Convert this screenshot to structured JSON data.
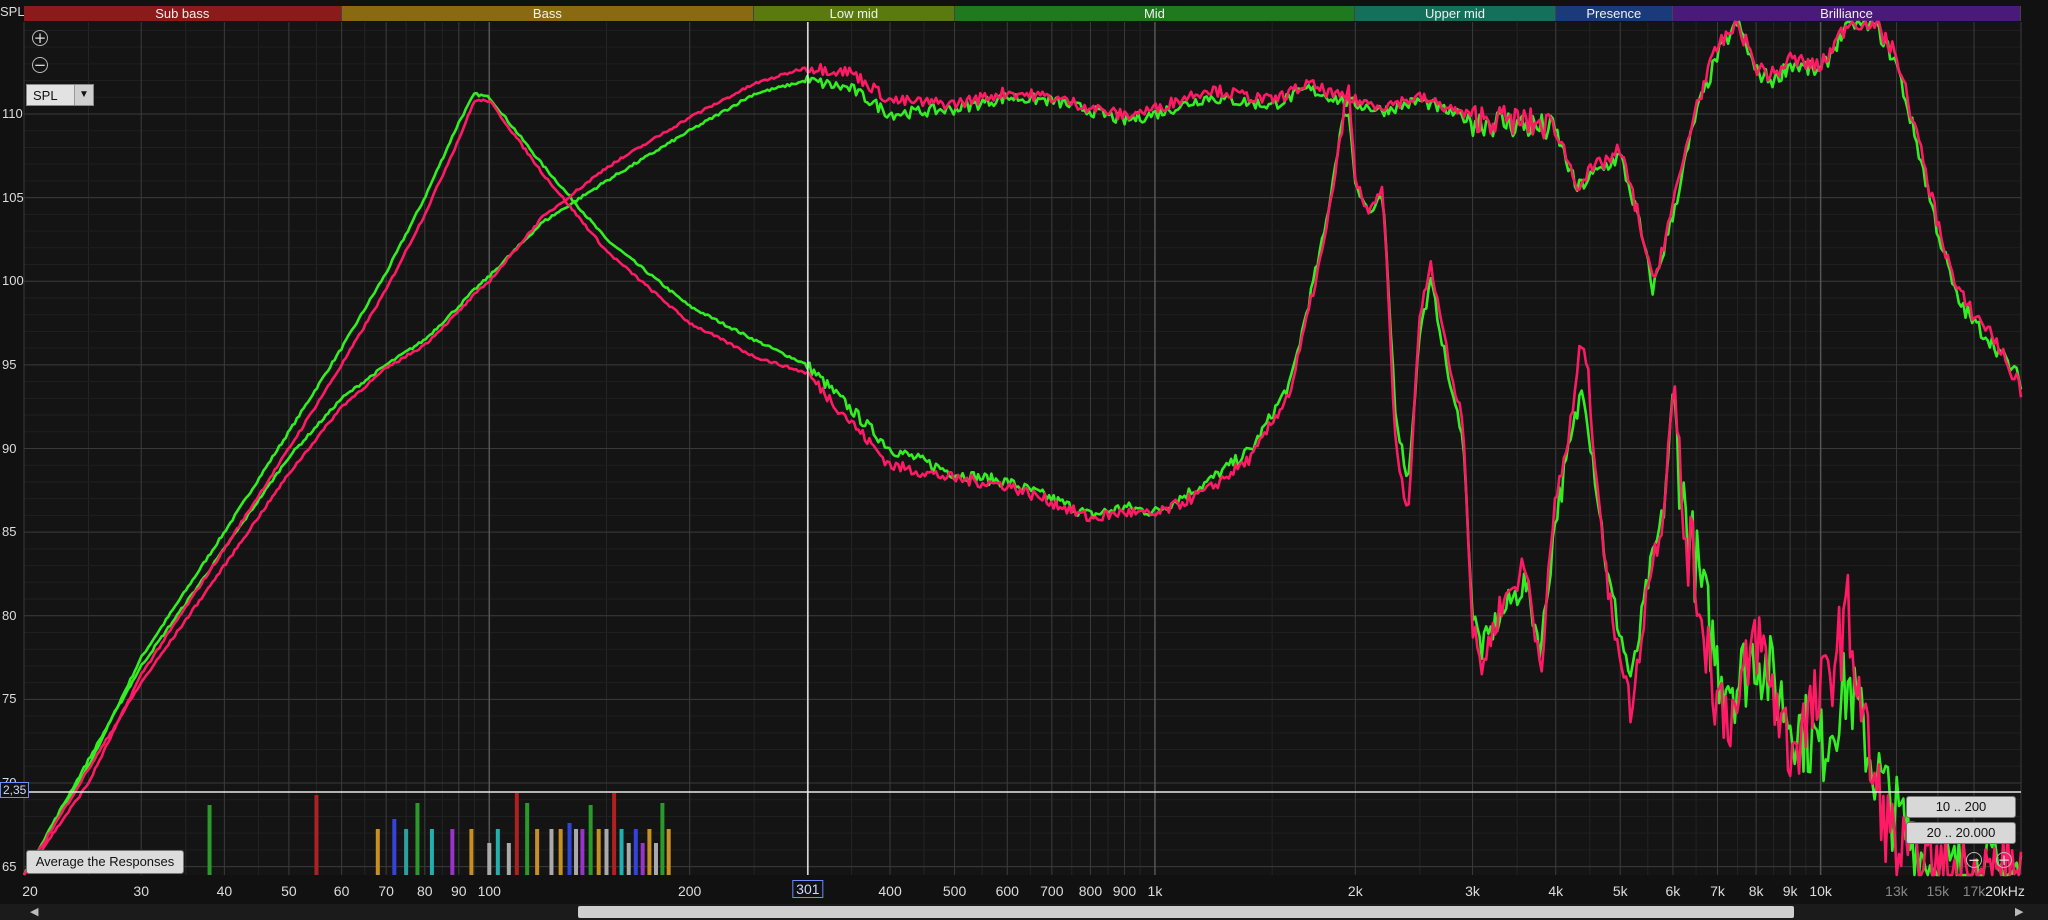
{
  "app": {
    "corner_label": "SPL"
  },
  "bands": [
    {
      "label": "Sub bass",
      "from": 20,
      "to": 60,
      "color": "#8b1a1a"
    },
    {
      "label": "Bass",
      "from": 60,
      "to": 250,
      "color": "#8a6a10"
    },
    {
      "label": "Low mid",
      "from": 250,
      "to": 500,
      "color": "#5a7a10"
    },
    {
      "label": "Mid",
      "from": 500,
      "to": 2000,
      "color": "#1f7a1f"
    },
    {
      "label": "Upper mid",
      "from": 2000,
      "to": 4000,
      "color": "#14705a"
    },
    {
      "label": "Presence",
      "from": 4000,
      "to": 6000,
      "color": "#1a3a7a"
    },
    {
      "label": "Brilliance",
      "from": 6000,
      "to": 20000,
      "color": "#4a1a7a"
    }
  ],
  "controls": {
    "zoom_in_symbol": "+",
    "zoom_out_symbol": "−",
    "measure_select_value": "SPL",
    "average_button": "Average the Responses",
    "range_button_1": "10 .. 200",
    "range_button_2": "20 .. 20.000",
    "scroll_left": "◀",
    "scroll_right": "▶"
  },
  "cursor": {
    "x_readout": "301",
    "y_readout": "2,35"
  },
  "chart_data": {
    "type": "line",
    "xscale": "log",
    "xlim": [
      20,
      20000
    ],
    "ylim": [
      64.5,
      115.5
    ],
    "grid": true,
    "x_ticks": [
      "20",
      "30",
      "40",
      "50",
      "60",
      "70",
      "80",
      "90",
      "100",
      "200",
      "301",
      "400",
      "500",
      "600",
      "700",
      "800",
      "900",
      "1k",
      "2k",
      "3k",
      "4k",
      "5k",
      "6k",
      "7k",
      "8k",
      "9k",
      "10k",
      "13k",
      "15k",
      "17k",
      "20kHz"
    ],
    "x_tick_values": [
      20,
      30,
      40,
      50,
      60,
      70,
      80,
      90,
      100,
      200,
      301,
      400,
      500,
      600,
      700,
      800,
      900,
      1000,
      2000,
      3000,
      4000,
      5000,
      6000,
      7000,
      8000,
      9000,
      10000,
      13000,
      15000,
      17000,
      20000
    ],
    "x_ticks_dim": [
      "13k",
      "15k",
      "17k"
    ],
    "y_ticks": [
      "110",
      "105",
      "100",
      "95",
      "90",
      "85",
      "80",
      "75",
      "70",
      "65"
    ],
    "y_tick_values": [
      110,
      105,
      100,
      95,
      90,
      85,
      80,
      75,
      70,
      65
    ],
    "series": [
      {
        "color": "#33ee22",
        "curve": "woofer",
        "points": [
          [
            20,
            64.5
          ],
          [
            25,
            71
          ],
          [
            30,
            77.5
          ],
          [
            40,
            85
          ],
          [
            50,
            91
          ],
          [
            60,
            96
          ],
          [
            70,
            100.5
          ],
          [
            80,
            105
          ],
          [
            90,
            109.5
          ],
          [
            95,
            111.2
          ],
          [
            100,
            111
          ],
          [
            120,
            107
          ],
          [
            150,
            102.5
          ],
          [
            200,
            98.5
          ],
          [
            250,
            96.5
          ],
          [
            300,
            95
          ],
          [
            400,
            90
          ],
          [
            500,
            88.5
          ],
          [
            600,
            88
          ],
          [
            700,
            87
          ],
          [
            800,
            86
          ],
          [
            900,
            86.5
          ],
          [
            1000,
            86.2
          ],
          [
            1200,
            88
          ],
          [
            1400,
            90
          ],
          [
            1600,
            94
          ],
          [
            1800,
            103
          ],
          [
            1900,
            109
          ],
          [
            1950,
            110.5
          ],
          [
            2000,
            106
          ],
          [
            2100,
            104
          ],
          [
            2200,
            105
          ],
          [
            2300,
            92
          ],
          [
            2400,
            88
          ],
          [
            2500,
            97
          ],
          [
            2600,
            100
          ],
          [
            2800,
            93
          ],
          [
            2900,
            91
          ],
          [
            3000,
            80
          ],
          [
            3100,
            78
          ],
          [
            3300,
            80
          ],
          [
            3600,
            82
          ],
          [
            3800,
            78
          ],
          [
            4000,
            86
          ],
          [
            4200,
            90
          ],
          [
            4400,
            94
          ],
          [
            4600,
            88
          ],
          [
            4800,
            82
          ],
          [
            5000,
            79
          ],
          [
            5200,
            76
          ],
          [
            5500,
            82
          ],
          [
            5800,
            86
          ],
          [
            6000,
            93
          ],
          [
            6200,
            87
          ],
          [
            6500,
            83
          ],
          [
            7000,
            77
          ],
          [
            7500,
            76
          ],
          [
            8000,
            78
          ],
          [
            9000,
            74
          ],
          [
            10000,
            72
          ],
          [
            11000,
            76
          ],
          [
            12000,
            71
          ],
          [
            13000,
            68
          ],
          [
            14000,
            66
          ],
          [
            15000,
            64.5
          ],
          [
            16000,
            64.5
          ],
          [
            20000,
            64.5
          ]
        ]
      },
      {
        "color": "#33ee22",
        "curve": "tweeter",
        "points": [
          [
            20,
            64.5
          ],
          [
            30,
            77
          ],
          [
            40,
            84
          ],
          [
            50,
            89.5
          ],
          [
            60,
            93
          ],
          [
            70,
            95
          ],
          [
            80,
            96.5
          ],
          [
            90,
            98.5
          ],
          [
            95,
            99.5
          ],
          [
            100,
            100.3
          ],
          [
            120,
            103.5
          ],
          [
            150,
            106
          ],
          [
            200,
            109
          ],
          [
            250,
            111.2
          ],
          [
            300,
            112
          ],
          [
            350,
            111.5
          ],
          [
            400,
            110
          ],
          [
            500,
            110.3
          ],
          [
            600,
            111
          ],
          [
            700,
            110.8
          ],
          [
            800,
            110.2
          ],
          [
            900,
            109.6
          ],
          [
            1000,
            110
          ],
          [
            1200,
            111
          ],
          [
            1500,
            110.5
          ],
          [
            1700,
            111.5
          ],
          [
            1900,
            110.8
          ],
          [
            2000,
            110.6
          ],
          [
            2200,
            110.2
          ],
          [
            2500,
            110.8
          ],
          [
            3000,
            109.6
          ],
          [
            3500,
            109.4
          ],
          [
            4000,
            109
          ],
          [
            4300,
            105.5
          ],
          [
            4600,
            106.5
          ],
          [
            5000,
            107.5
          ],
          [
            5300,
            104
          ],
          [
            5600,
            99.5
          ],
          [
            6000,
            104
          ],
          [
            6500,
            110
          ],
          [
            7000,
            113.5
          ],
          [
            7500,
            115.5
          ],
          [
            8000,
            112.5
          ],
          [
            8500,
            112
          ],
          [
            9000,
            113
          ],
          [
            10000,
            112.5
          ],
          [
            11000,
            115.5
          ],
          [
            12000,
            115.5
          ],
          [
            13000,
            113
          ],
          [
            14000,
            108
          ],
          [
            15000,
            103
          ],
          [
            16000,
            99
          ],
          [
            17000,
            97.5
          ],
          [
            18000,
            96.5
          ],
          [
            20000,
            94
          ]
        ]
      },
      {
        "color": "#ff1a66",
        "curve": "woofer",
        "points": [
          [
            20,
            64.5
          ],
          [
            25,
            70
          ],
          [
            30,
            76.5
          ],
          [
            40,
            84
          ],
          [
            50,
            90
          ],
          [
            60,
            95
          ],
          [
            70,
            99.5
          ],
          [
            80,
            104
          ],
          [
            90,
            108.5
          ],
          [
            95,
            110.8
          ],
          [
            100,
            110.8
          ],
          [
            120,
            106.5
          ],
          [
            150,
            101.8
          ],
          [
            200,
            97.5
          ],
          [
            250,
            95.5
          ],
          [
            300,
            94.5
          ],
          [
            400,
            89
          ],
          [
            500,
            88.2
          ],
          [
            600,
            87.8
          ],
          [
            700,
            86.8
          ],
          [
            800,
            85.8
          ],
          [
            900,
            86.2
          ],
          [
            1000,
            86
          ],
          [
            1200,
            87.5
          ],
          [
            1400,
            89.5
          ],
          [
            1600,
            93.5
          ],
          [
            1800,
            102.5
          ],
          [
            1900,
            108.5
          ],
          [
            1950,
            112
          ],
          [
            2000,
            106
          ],
          [
            2100,
            104
          ],
          [
            2200,
            105.5
          ],
          [
            2300,
            90
          ],
          [
            2400,
            86
          ],
          [
            2500,
            98
          ],
          [
            2600,
            101
          ],
          [
            2800,
            94
          ],
          [
            2900,
            92
          ],
          [
            3000,
            79
          ],
          [
            3100,
            77
          ],
          [
            3300,
            80.5
          ],
          [
            3600,
            83
          ],
          [
            3800,
            77
          ],
          [
            4000,
            87
          ],
          [
            4200,
            91
          ],
          [
            4400,
            97
          ],
          [
            4600,
            89
          ],
          [
            4800,
            81
          ],
          [
            5000,
            78
          ],
          [
            5200,
            74
          ],
          [
            5500,
            82
          ],
          [
            5800,
            86
          ],
          [
            6000,
            94
          ],
          [
            6200,
            86
          ],
          [
            6500,
            82
          ],
          [
            7000,
            75
          ],
          [
            7500,
            74
          ],
          [
            8000,
            79
          ],
          [
            9000,
            72
          ],
          [
            10000,
            75
          ],
          [
            11000,
            80
          ],
          [
            12000,
            70
          ],
          [
            13000,
            66
          ],
          [
            14000,
            65
          ],
          [
            15000,
            64.5
          ],
          [
            16000,
            64.5
          ],
          [
            20000,
            64.5
          ]
        ]
      },
      {
        "color": "#ff1a66",
        "curve": "tweeter",
        "points": [
          [
            20,
            64.5
          ],
          [
            30,
            76
          ],
          [
            40,
            83
          ],
          [
            50,
            88.5
          ],
          [
            60,
            92.5
          ],
          [
            70,
            94.8
          ],
          [
            80,
            96.2
          ],
          [
            90,
            98.2
          ],
          [
            95,
            99.2
          ],
          [
            100,
            100
          ],
          [
            120,
            103.8
          ],
          [
            150,
            106.8
          ],
          [
            200,
            109.8
          ],
          [
            250,
            111.8
          ],
          [
            300,
            112.8
          ],
          [
            350,
            112.5
          ],
          [
            400,
            110.8
          ],
          [
            500,
            110.6
          ],
          [
            600,
            111.3
          ],
          [
            700,
            111
          ],
          [
            800,
            110.4
          ],
          [
            900,
            109.9
          ],
          [
            1000,
            110.3
          ],
          [
            1200,
            111.5
          ],
          [
            1500,
            110.8
          ],
          [
            1700,
            111.8
          ],
          [
            1900,
            111
          ],
          [
            2000,
            110.8
          ],
          [
            2200,
            110.5
          ],
          [
            2500,
            111
          ],
          [
            3000,
            109.8
          ],
          [
            3500,
            109.6
          ],
          [
            4000,
            109.2
          ],
          [
            4300,
            105.8
          ],
          [
            4600,
            106.8
          ],
          [
            5000,
            107.8
          ],
          [
            5300,
            104.2
          ],
          [
            5600,
            99.8
          ],
          [
            6000,
            104.5
          ],
          [
            6500,
            110.5
          ],
          [
            7000,
            114
          ],
          [
            7500,
            115.5
          ],
          [
            8000,
            112.8
          ],
          [
            8500,
            112.3
          ],
          [
            9000,
            113.3
          ],
          [
            10000,
            112.8
          ],
          [
            11000,
            115.5
          ],
          [
            12000,
            115.5
          ],
          [
            13000,
            113.5
          ],
          [
            14000,
            108.5
          ],
          [
            15000,
            103.5
          ],
          [
            16000,
            99.5
          ],
          [
            17000,
            98
          ],
          [
            18000,
            97
          ],
          [
            20000,
            93.5
          ]
        ]
      }
    ]
  }
}
